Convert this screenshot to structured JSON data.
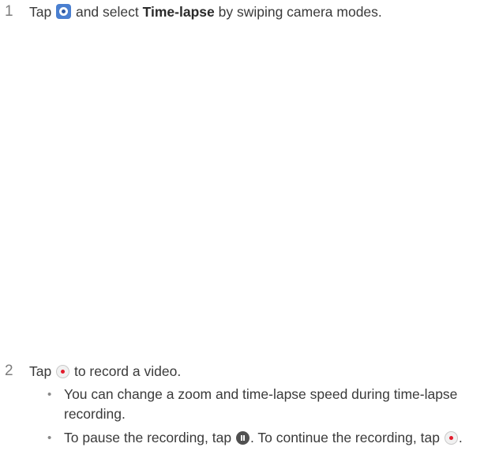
{
  "step1": {
    "number": "1",
    "tap": "Tap",
    "icon": "camera-app-icon",
    "middle": "and select",
    "mode": "Time-lapse",
    "end": "by swiping camera modes."
  },
  "step2": {
    "number": "2",
    "tap": "Tap",
    "icon": "record-icon",
    "end": "to record a video."
  },
  "bullets": {
    "b1_line1": "You can change a zoom and time-lapse speed during time-lapse",
    "b1_line2": "recording.",
    "b2_part1": "To pause the recording, tap",
    "b2_part2": ". To continue the recording, tap",
    "b2_part3": "."
  },
  "colors": {
    "record_red": "#e21b2c",
    "camera_blue": "#4a7fd0"
  }
}
